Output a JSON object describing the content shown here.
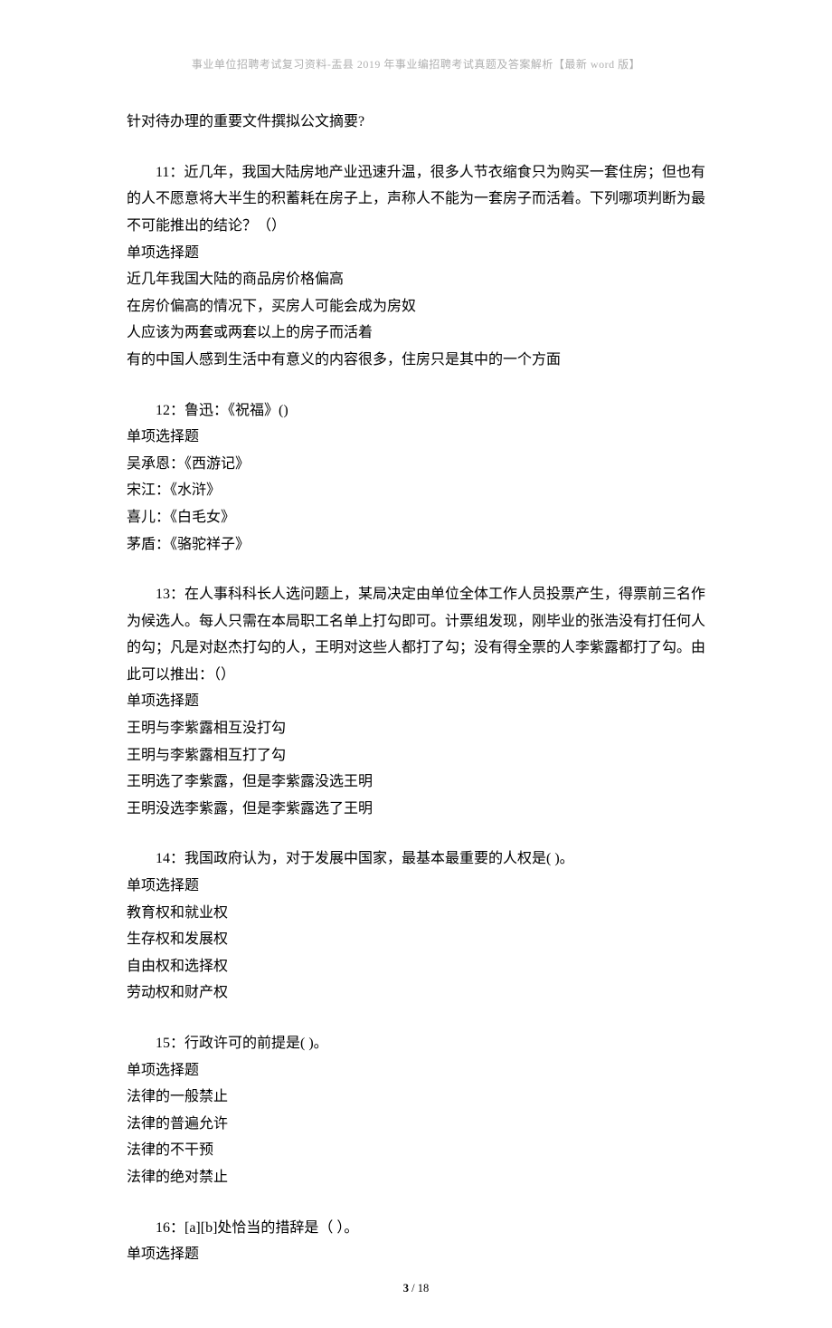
{
  "header": "事业单位招聘考试复习资料-盂县 2019 年事业编招聘考试真题及答案解析【最新 word 版】",
  "q10_tail": "针对待办理的重要文件撰拟公文摘要?",
  "q11": {
    "stem": "11：近几年，我国大陆房地产业迅速升温，很多人节衣缩食只为购买一套住房；但也有的人不愿意将大半生的积蓄耗在房子上，声称人不能为一套房子而活着。下列哪项判断为最不可能推出的结论？（）",
    "type": "单项选择题",
    "a": "近几年我国大陆的商品房价格偏高",
    "b": "在房价偏高的情况下，买房人可能会成为房奴",
    "c": "人应该为两套或两套以上的房子而活着",
    "d": "有的中国人感到生活中有意义的内容很多，住房只是其中的一个方面"
  },
  "q12": {
    "stem": "12：鲁迅：《祝福》()",
    "type": "单项选择题",
    "a": "吴承恩：《西游记》",
    "b": "宋江：《水浒》",
    "c": "喜儿：《白毛女》",
    "d": "茅盾：《骆驼祥子》"
  },
  "q13": {
    "stem": "13：在人事科科长人选问题上，某局决定由单位全体工作人员投票产生，得票前三名作为候选人。每人只需在本局职工名单上打勾即可。计票组发现，刚毕业的张浩没有打任何人的勾；凡是对赵杰打勾的人，王明对这些人都打了勾；没有得全票的人李紫露都打了勾。由此可以推出：（）",
    "type": "单项选择题",
    "a": "王明与李紫露相互没打勾",
    "b": "王明与李紫露相互打了勾",
    "c": "王明选了李紫露，但是李紫露没选王明",
    "d": "王明没选李紫露，但是李紫露选了王明"
  },
  "q14": {
    "stem": "14：我国政府认为，对于发展中国家，最基本最重要的人权是( )。",
    "type": "单项选择题",
    "a": "教育权和就业权",
    "b": "生存权和发展权",
    "c": "自由权和选择权",
    "d": "劳动权和财产权"
  },
  "q15": {
    "stem": "15：行政许可的前提是( )。",
    "type": "单项选择题",
    "a": "法律的一般禁止",
    "b": "法律的普遍允许",
    "c": "法律的不干预",
    "d": "法律的绝对禁止"
  },
  "q16": {
    "stem": "16：[a][b]处恰当的措辞是（ ）。",
    "type": "单项选择题"
  },
  "footer": {
    "current": "3",
    "sep": " / ",
    "total": "18"
  }
}
